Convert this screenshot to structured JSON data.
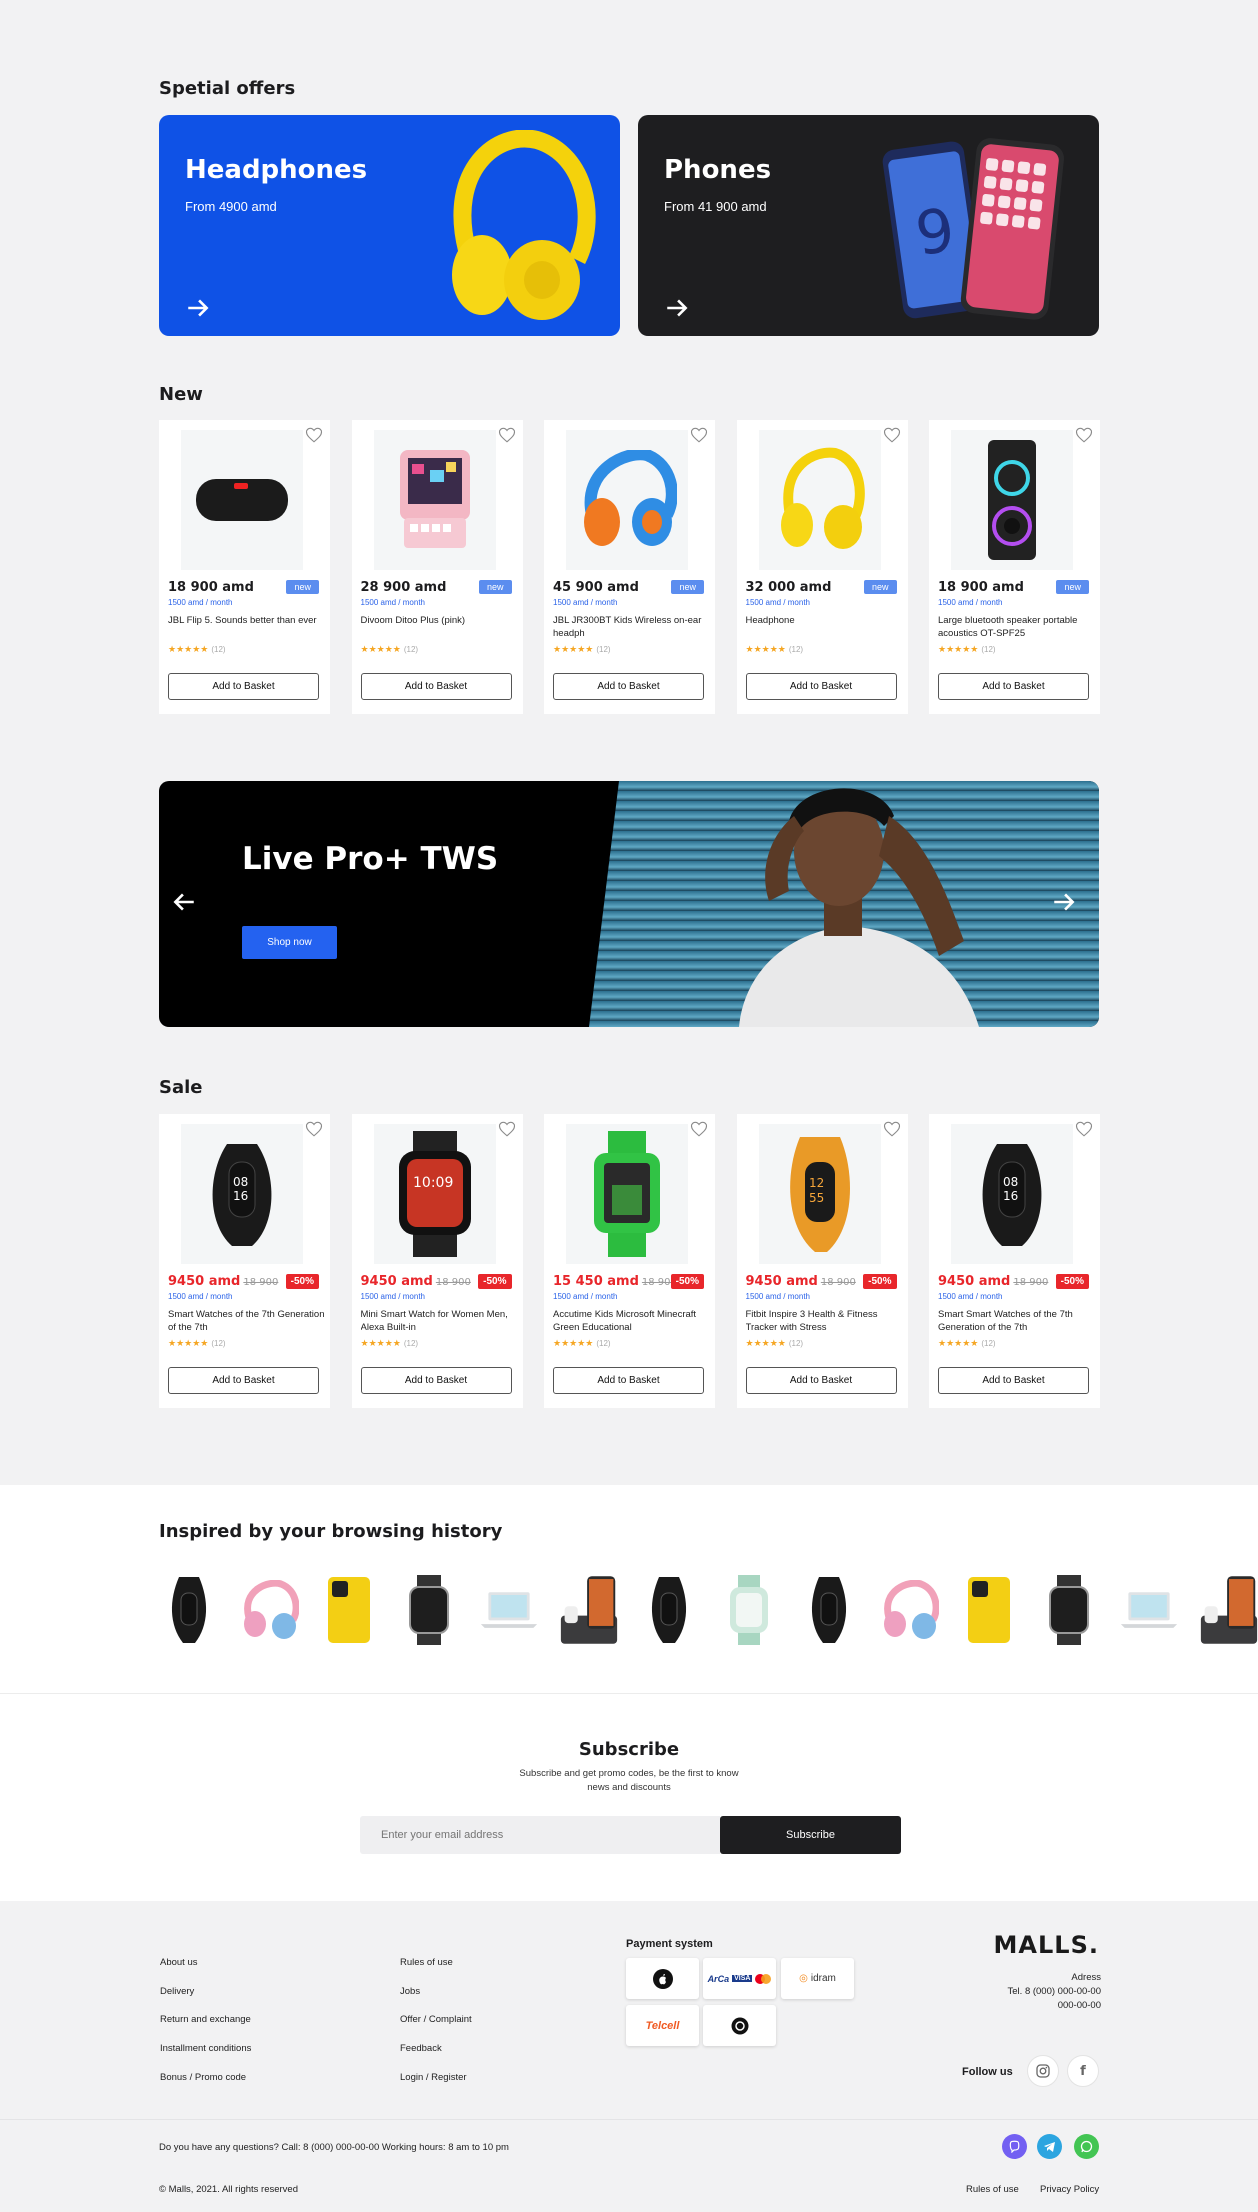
{
  "special_offers": {
    "title": "Spetial offers",
    "items": [
      {
        "title": "Headphones",
        "subtitle": "From 4900 amd"
      },
      {
        "title": "Phones",
        "subtitle": "From 41 900 amd"
      }
    ]
  },
  "new_section": {
    "title": "New",
    "products": [
      {
        "price": "18 900 amd",
        "badge": "new",
        "monthly": "1500 amd / month",
        "name": "JBL Flip 5. Sounds better than ever",
        "stars": "★★★★★",
        "count": "(12)",
        "button": "Add to Basket",
        "icon": "speaker-black"
      },
      {
        "price": "28 900 amd",
        "badge": "new",
        "monthly": "1500 amd / month",
        "name": "Divoom Ditoo Plus (pink)",
        "stars": "★★★★★",
        "count": "(12)",
        "button": "Add to Basket",
        "icon": "pixel-speaker-pink"
      },
      {
        "price": "45 900 amd",
        "badge": "new",
        "monthly": "1500 amd / month",
        "name": "JBL JR300BT Kids Wireless on-ear headph",
        "stars": "★★★★★",
        "count": "(12)",
        "button": "Add to Basket",
        "icon": "headphones-blue"
      },
      {
        "price": "32 000 amd",
        "badge": "new",
        "monthly": "1500 amd / month",
        "name": "Headphone",
        "stars": "★★★★★",
        "count": "(12)",
        "button": "Add to Basket",
        "icon": "headphones-yellow"
      },
      {
        "price": "18 900 amd",
        "badge": "new",
        "monthly": "1500 amd / month",
        "name": "Large bluetooth speaker portable acoustics OT-SPF25",
        "stars": "★★★★★",
        "count": "(12)",
        "button": "Add to Basket",
        "icon": "party-speaker"
      }
    ]
  },
  "banner": {
    "title": "Live Pro+ TWS",
    "button": "Shop now"
  },
  "sale_section": {
    "title": "Sale",
    "products": [
      {
        "price": "9450 amd",
        "old_price": "18 900",
        "badge": "-50%",
        "monthly": "1500 amd / month",
        "name": "Smart Watches of the 7th Generation of the 7th",
        "stars": "★★★★★",
        "count": "(12)",
        "button": "Add to Basket",
        "icon": "band-black"
      },
      {
        "price": "9450 amd",
        "old_price": "18 900",
        "badge": "-50%",
        "monthly": "1500 amd / month",
        "name": " Mini Smart Watch for Women Men, Alexa Built-in",
        "stars": "★★★★★",
        "count": "(12)",
        "button": "Add to Basket",
        "icon": "watch-black"
      },
      {
        "price": "15 450 amd",
        "old_price": "18 900",
        "badge": "-50%",
        "monthly": "1500 amd / month",
        "name": "Accutime Kids Microsoft Minecraft Green Educational",
        "stars": "★★★★★",
        "count": "(12)",
        "button": "Add to Basket",
        "icon": "watch-green"
      },
      {
        "price": "9450 amd",
        "old_price": "18 900",
        "badge": "-50%",
        "monthly": "1500 amd / month",
        "name": "Fitbit Inspire 3 Health & Fitness Tracker with Stress",
        "stars": "★★★★★",
        "count": "(12)",
        "button": "Add to Basket",
        "icon": "band-orange"
      },
      {
        "price": "9450 amd",
        "old_price": "18 900",
        "badge": "-50%",
        "monthly": "1500 amd / month",
        "name": "Smart Smart Watches of the 7th Generation of the 7th",
        "stars": "★★★★★",
        "count": "(12)",
        "button": "Add to Basket",
        "icon": "band-black"
      }
    ]
  },
  "history": {
    "title": "Inspired by your browsing history"
  },
  "subscribe": {
    "title": "Subscribe",
    "text_line1": "Subscribe and get promo codes, be the first to know",
    "text_line2": "news and discounts",
    "placeholder": "Enter your email address",
    "button": "Subscribe"
  },
  "footer": {
    "col1": [
      "About us",
      "Delivery",
      "Return and exchange",
      "Installment conditions",
      "Bonus / Promo code"
    ],
    "col2": [
      "Rules of use",
      "Jobs",
      "Offer / Complaint",
      "Feedback",
      "Login / Register"
    ],
    "payment_title": "Payment system",
    "payments": [
      {
        "name": "Apple Pay",
        "label": ""
      },
      {
        "name": "ArCa VISA",
        "label": ""
      },
      {
        "name": "idram",
        "label": ""
      },
      {
        "name": "Telcell",
        "label": ""
      },
      {
        "name": "Easypay",
        "label": ""
      }
    ],
    "logo": "MALLS.",
    "adress_label": "Adress",
    "tel_line1": "Tel. 8 (000) 000-00-00",
    "tel_line2": "000-00-00",
    "follow": "Follow us",
    "question": "Do you have any questions? Call: 8 (000) 000-00-00 Working hours: 8 am to 10 pm",
    "copyright": "© Malls, 2021. All rights reserved",
    "rules": "Rules of use",
    "privacy": "Privacy Policy"
  }
}
